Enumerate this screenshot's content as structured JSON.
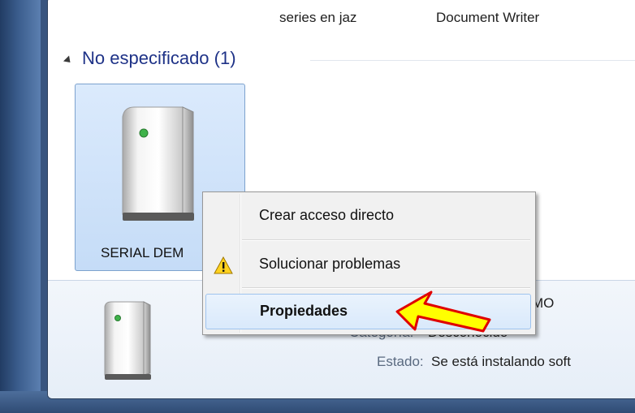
{
  "top_labels": {
    "left": "series en jaz",
    "right": "Document Writer"
  },
  "group": {
    "title": "No especificado (1)"
  },
  "device": {
    "label": "SERIAL DEM"
  },
  "details": {
    "name_suffix": "MO",
    "category_label": "Categoría:",
    "category_value": "Desconocido",
    "status_label": "Estado:",
    "status_value": "Se está instalando soft"
  },
  "context_menu": {
    "items": [
      {
        "label": "Crear acceso directo",
        "icon": "none"
      },
      {
        "label": "Solucionar problemas",
        "icon": "warning-icon"
      },
      {
        "label": "Propiedades",
        "icon": "none",
        "bold": true,
        "highlighted": true
      }
    ]
  },
  "annotation": {
    "arrow_colors": {
      "fill": "#ffff00",
      "stroke": "#e00000"
    }
  }
}
